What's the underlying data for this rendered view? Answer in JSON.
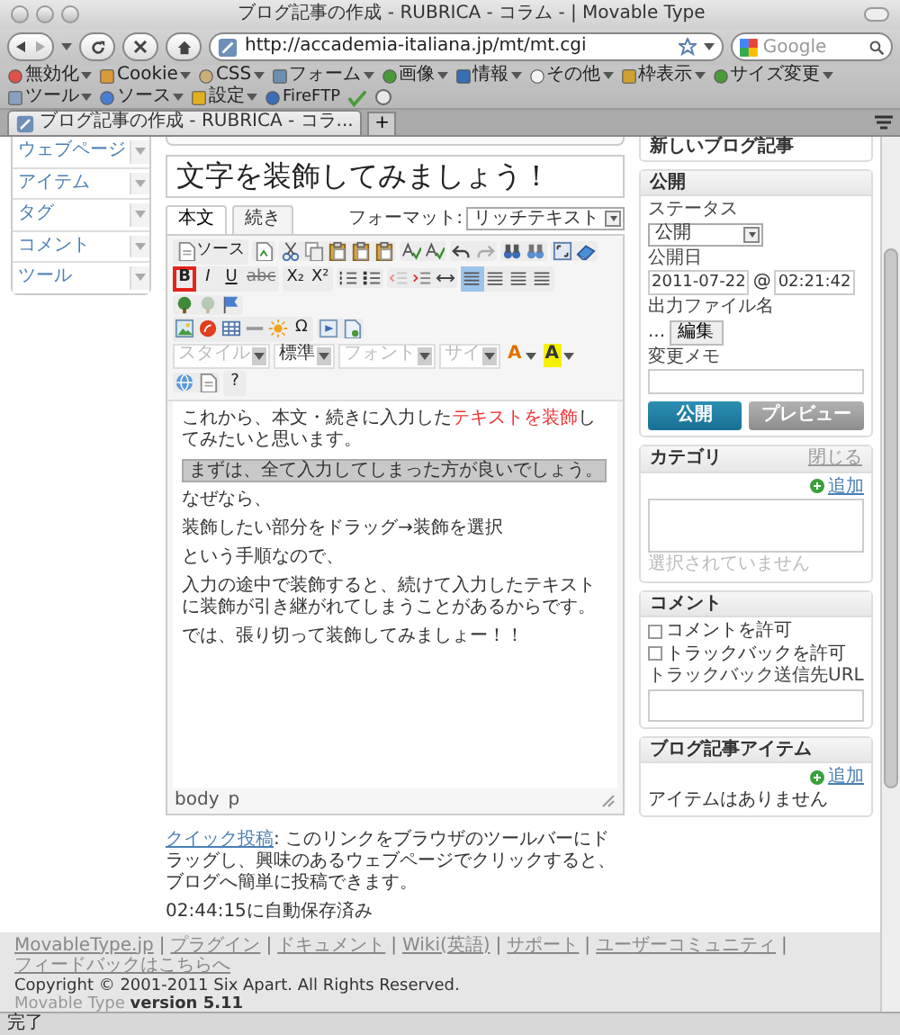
{
  "window": {
    "title": "ブログ記事の作成 - RUBRICA - コラム - | Movable Type"
  },
  "address_bar": {
    "url": "http://accademia-italiana.jp/mt/mt.cgi"
  },
  "search": {
    "placeholder": "Google"
  },
  "bookmarks": [
    {
      "label": "無効化",
      "kind": "menu"
    },
    {
      "label": "Cookie",
      "kind": "menu"
    },
    {
      "label": "CSS",
      "kind": "menu"
    },
    {
      "label": "フォーム",
      "kind": "menu"
    },
    {
      "label": "画像",
      "kind": "menu"
    },
    {
      "label": "情報",
      "kind": "menu"
    },
    {
      "label": "その他",
      "kind": "menu"
    },
    {
      "label": "枠表示",
      "kind": "menu"
    },
    {
      "label": "サイズ変更",
      "kind": "menu"
    },
    {
      "label": "ツール",
      "kind": "menu"
    },
    {
      "label": "ソース",
      "kind": "menu"
    },
    {
      "label": "設定",
      "kind": "menu"
    },
    {
      "label": "FireFTP",
      "kind": "stacked"
    }
  ],
  "tabs": [
    {
      "label": "ブログ記事の作成 - RUBRICA - コラ...",
      "selected": true
    }
  ],
  "new_tab": "+",
  "sidebar": {
    "items": [
      {
        "label": "ウェブページ"
      },
      {
        "label": "アイテム"
      },
      {
        "label": "タグ"
      },
      {
        "label": "コメント"
      },
      {
        "label": "ツール"
      }
    ]
  },
  "entry": {
    "title": "文字を装飾してみましょう！",
    "tabs": [
      {
        "label": "本文",
        "selected": true
      },
      {
        "label": "続き",
        "selected": false
      }
    ],
    "format_label": "フォーマット:",
    "format_value": "リッチテキスト",
    "toolbar": {
      "source_label": "ソース",
      "format_buttons": [
        {
          "label": "B",
          "highlighted": true
        },
        {
          "label": "I",
          "highlighted": false
        },
        {
          "label": "U",
          "highlighted": false
        },
        {
          "label": "abc",
          "highlighted": false
        }
      ],
      "script_buttons": [
        {
          "label": "X₂"
        },
        {
          "label": "X²"
        }
      ],
      "align_buttons": [
        {
          "selected": true
        },
        {
          "selected": false
        },
        {
          "selected": false
        },
        {
          "selected": false
        }
      ],
      "special_char": "Ω",
      "dropdowns": [
        {
          "label": "スタイル",
          "disabled": true
        },
        {
          "label": "標準",
          "disabled": false
        },
        {
          "label": "フォント",
          "disabled": true
        },
        {
          "label": "サイ",
          "disabled": true
        }
      ],
      "color_buttons": [
        {
          "label": "A",
          "kind": "text"
        },
        {
          "label": "A",
          "kind": "background"
        }
      ],
      "help": "?"
    },
    "paragraphs": [
      {
        "selected": false,
        "segments": [
          {
            "text": "これから、本文・続きに入力した",
            "kind": "plain"
          },
          {
            "text": "テキストを装飾",
            "kind": "red"
          },
          {
            "text": "してみたいと思います。",
            "kind": "plain"
          }
        ]
      },
      {
        "selected": true,
        "segments": [
          {
            "text": "まずは、全て入力してしまった方が良いでしょう。",
            "kind": "plain"
          }
        ]
      },
      {
        "selected": false,
        "segments": [
          {
            "text": "なぜなら、",
            "kind": "plain"
          }
        ]
      },
      {
        "selected": false,
        "segments": [
          {
            "text": "装飾したい部分をドラッグ→装飾を選択",
            "kind": "plain"
          }
        ]
      },
      {
        "selected": false,
        "segments": [
          {
            "text": "という手順なので、",
            "kind": "plain"
          }
        ]
      },
      {
        "selected": false,
        "segments": [
          {
            "text": "入力の途中で装飾すると、続けて入力したテキストに装飾が引き継がれてしまうことがあるからです。",
            "kind": "plain"
          }
        ]
      },
      {
        "selected": false,
        "segments": [
          {
            "text": "では、張り切って装飾してみましょー！！",
            "kind": "plain"
          }
        ]
      }
    ],
    "path": [
      "body",
      "p"
    ]
  },
  "quick_post": {
    "link": "クイック投稿",
    "text": ": このリンクをブラウザのツールバーにドラッグし、興味のあるウェブページでクリックすると、ブログへ簡単に投稿できます。"
  },
  "autosave": "02:44:15に自動保存済み",
  "top_card": {
    "label": "新しいブログ記事"
  },
  "publish": {
    "title": "公開",
    "status_label": "ステータス",
    "status_value": "公開",
    "date_label": "公開日",
    "date": "2011-07-22",
    "at": "@",
    "time": "02:21:42",
    "file_label": "出力ファイル名",
    "file_value": "...",
    "edit_button": "編集",
    "memo_label": "変更メモ",
    "publish_button": "公開",
    "preview_button": "プレビュー"
  },
  "category": {
    "title": "カテゴリ",
    "close": "閉じる",
    "add": "追加",
    "empty": "選択されていません"
  },
  "comments": {
    "title": "コメント",
    "options": [
      {
        "label": "コメントを許可",
        "checked": false
      },
      {
        "label": "トラックバックを許可",
        "checked": false
      }
    ],
    "trackback_label": "トラックバック送信先URL"
  },
  "items": {
    "title": "ブログ記事アイテム",
    "add": "追加",
    "empty": "アイテムはありません"
  },
  "footer": {
    "links": [
      "MovableType.jp",
      "プラグイン",
      "ドキュメント",
      "Wiki(英語)",
      "サポート",
      "ユーザーコミュニティ",
      "フィードバックはこちらへ"
    ],
    "separator": "|",
    "copyright": "Copyright © 2001-2011 Six Apart. All Rights Reserved.",
    "version": "Movable Type **version 5.11**"
  },
  "status_bar": {
    "text": "完了"
  }
}
